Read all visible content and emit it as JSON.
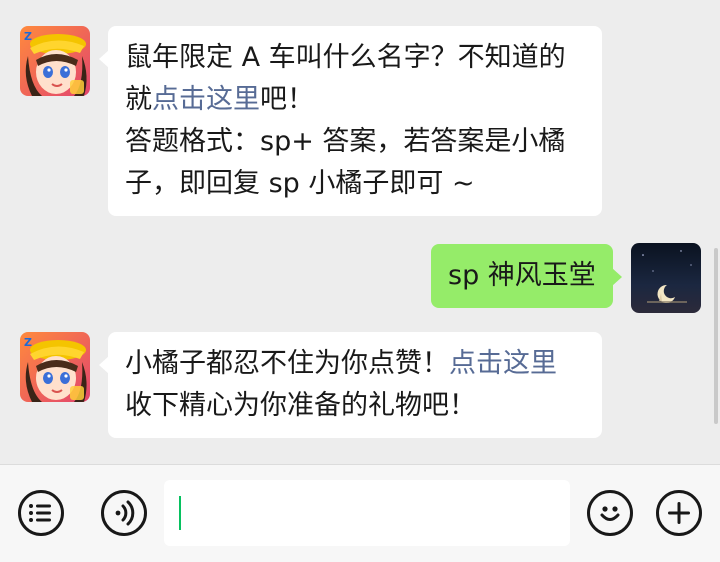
{
  "messages": [
    {
      "side": "left",
      "sender_icon": "game-app-avatar",
      "lines": [
        [
          {
            "text": "鼠年限定 A 车叫什么名字？不知道的",
            "link": false
          }
        ],
        [
          {
            "text": "就",
            "link": false
          },
          {
            "text": "点击这里",
            "link": true
          },
          {
            "text": "吧！",
            "link": false
          }
        ],
        [
          {
            "text": "答题格式：sp+ 答案，若答案是小橘",
            "link": false
          }
        ],
        [
          {
            "text": "子，即回复 sp 小橘子即可 ~",
            "link": false
          }
        ]
      ]
    },
    {
      "side": "right",
      "sender_icon": "moon-night-avatar",
      "lines": [
        [
          {
            "text": "sp 神风玉堂",
            "link": false
          }
        ]
      ]
    },
    {
      "side": "left",
      "sender_icon": "game-app-avatar",
      "lines": [
        [
          {
            "text": "小橘子都忍不住为你点赞！",
            "link": false
          },
          {
            "text": "点击这里",
            "link": true
          }
        ],
        [
          {
            "text": "收下精心为你准备的礼物吧！",
            "link": false
          }
        ]
      ]
    }
  ],
  "input_bar": {
    "input_value": "",
    "icons": [
      "menu-list-icon",
      "voice-icon",
      "emoji-icon",
      "plus-icon"
    ]
  },
  "colors": {
    "background": "#ededed",
    "bubble_left": "#ffffff",
    "bubble_right": "#95ec69",
    "link": "#576b95",
    "caret": "#07c160"
  }
}
